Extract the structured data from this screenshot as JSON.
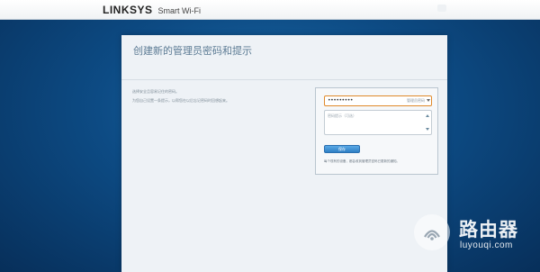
{
  "header": {
    "brand": "LINKSYS",
    "subtitle": "Smart Wi-Fi"
  },
  "panel": {
    "title": "创建新的管理员密码和提示",
    "description": [
      "选择安全且容易记住的密码。",
      "为您自己设置一条提示，以帮您在以后忘记密码时回想起来。"
    ]
  },
  "form": {
    "password_value": "•••••••••",
    "password_hint_label": "管理员密码",
    "hint_placeholder": "密码提示（可选）",
    "save_label": "保存",
    "note": "每个现有的设备，都会收到管理员密码已更新的通知。"
  },
  "watermark": {
    "title": "路由器",
    "url": "luyouqi.com"
  },
  "colors": {
    "background": "#0d4b84",
    "accent": "#2f7fc4",
    "input_focus": "#e08a2b"
  }
}
